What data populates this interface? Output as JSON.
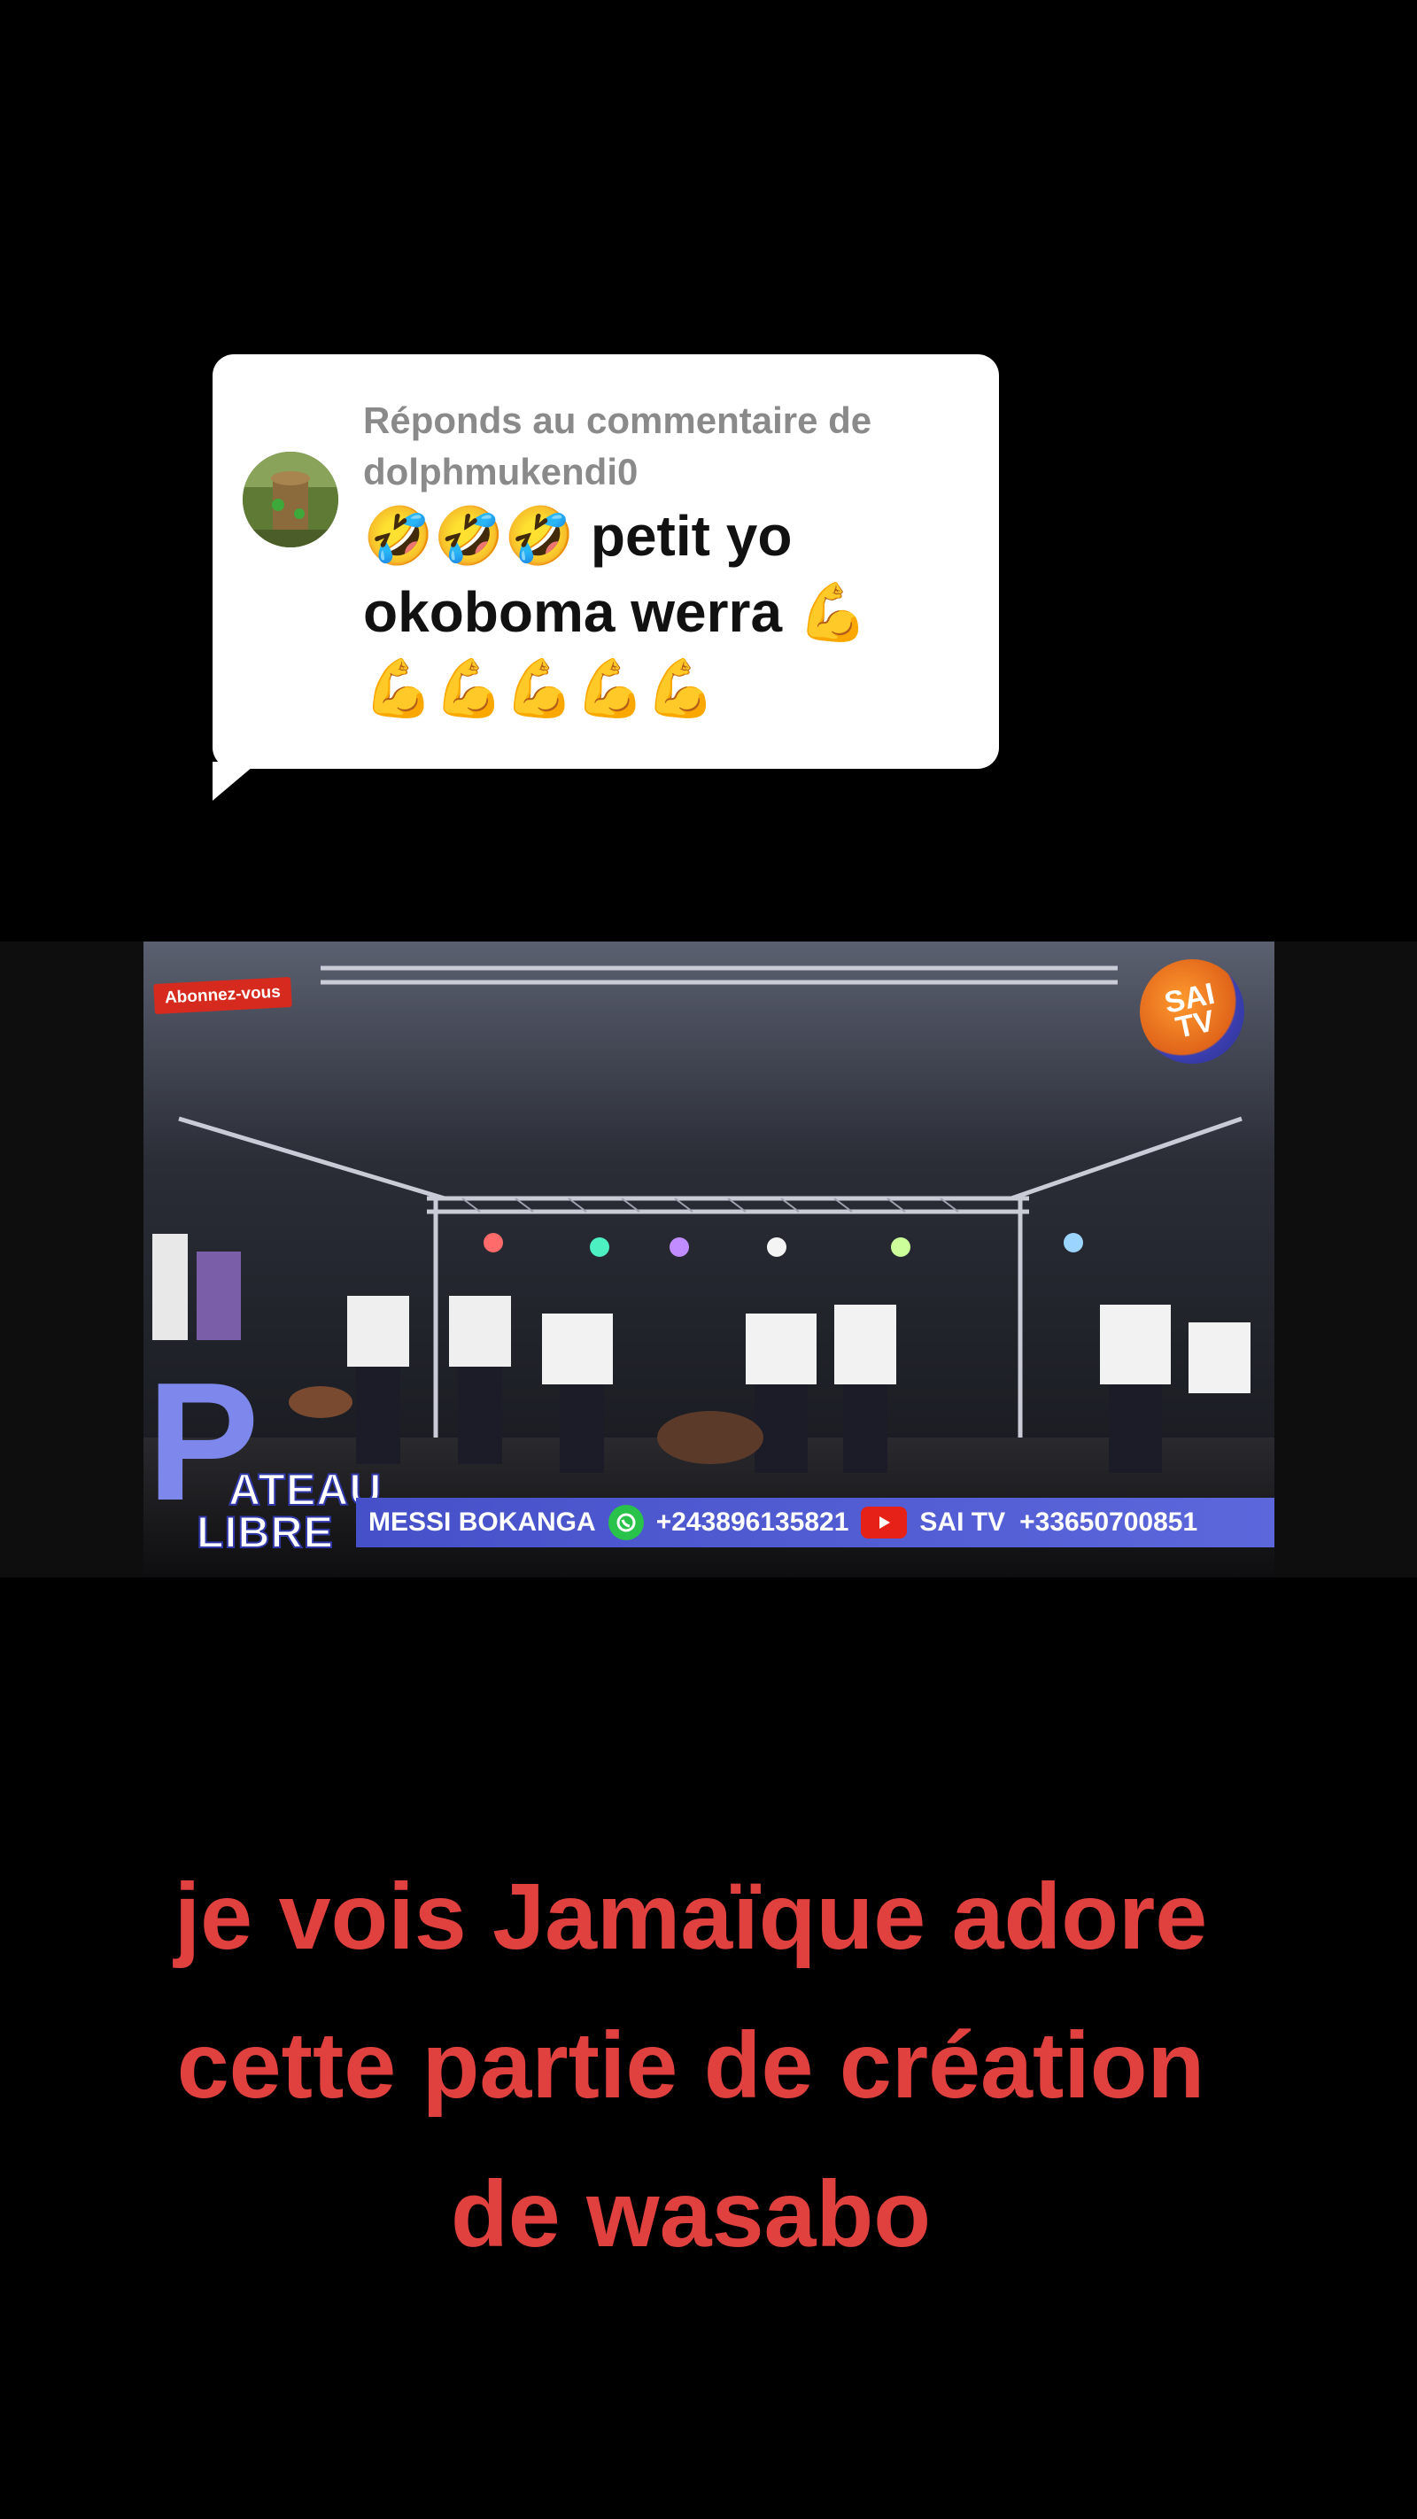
{
  "reply": {
    "header_line1": "Réponds au commentaire de",
    "header_line2": "dolphmukendi0",
    "comment_text": "🤣🤣🤣 petit yo\nokoboma werra 💪\n💪💪💪💪💪"
  },
  "video": {
    "subscribe_badge": "Abonnez-vous",
    "channel_logo_text": "SAI\nTV",
    "show_logo_letter": "P",
    "show_logo_word1": "ATEAU",
    "show_logo_word2": "LIBRE",
    "ticker": {
      "name": "MESSI BOKANGA",
      "phone1": "+243896135821",
      "channel": "SAI TV",
      "phone2": "+33650700851"
    }
  },
  "caption": {
    "line1": "je  vois Jamaïque adore",
    "line2": "cette partie de création",
    "line3": "de wasabo"
  },
  "colors": {
    "background": "#000000",
    "caption": "#e0403e",
    "bubble": "#ffffff",
    "ticker": "#5059d0"
  }
}
